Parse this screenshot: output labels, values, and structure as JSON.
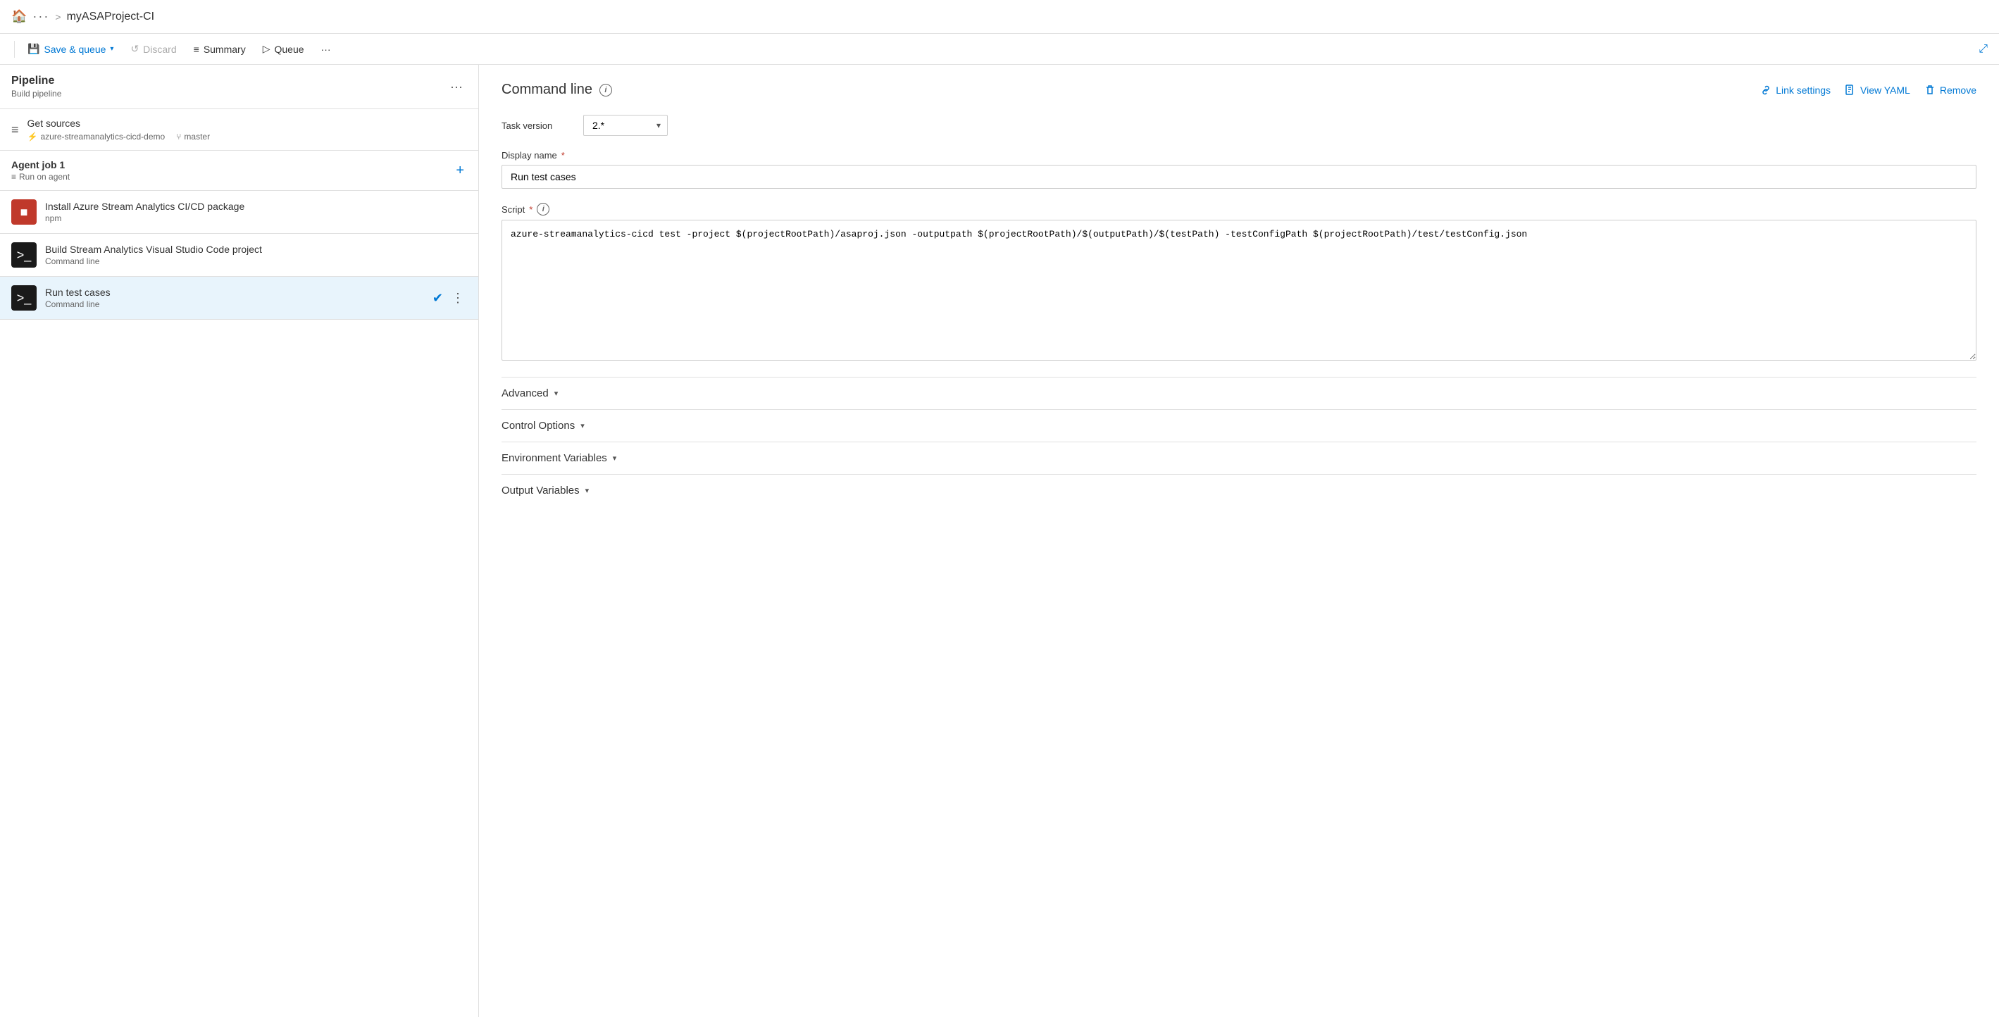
{
  "topbar": {
    "icon": "🏠",
    "dots": "···",
    "separator": ">",
    "title": "myASAProject-CI"
  },
  "toolbar": {
    "save_queue": "Save & queue",
    "discard": "Discard",
    "summary": "Summary",
    "queue": "Queue",
    "more": "···",
    "expand": "⤢"
  },
  "left_panel": {
    "pipeline_title": "Pipeline",
    "pipeline_subtitle": "Build pipeline",
    "get_sources_title": "Get sources",
    "get_sources_repo": "azure-streamanalytics-cicd-demo",
    "get_sources_branch": "master",
    "agent_job_title": "Agent job 1",
    "agent_job_sub": "Run on agent",
    "tasks": [
      {
        "id": "install",
        "icon_type": "red",
        "icon_text": "■",
        "title": "Install Azure Stream Analytics CI/CD package",
        "subtitle": "npm",
        "selected": false
      },
      {
        "id": "build",
        "icon_type": "dark",
        "icon_text": ">_",
        "title": "Build Stream Analytics Visual Studio Code project",
        "subtitle": "Command line",
        "selected": false
      },
      {
        "id": "run",
        "icon_type": "dark",
        "icon_text": ">_",
        "title": "Run test cases",
        "subtitle": "Command line",
        "selected": true
      }
    ]
  },
  "right_panel": {
    "command_title": "Command line",
    "info_icon": "i",
    "link_settings": "Link settings",
    "view_yaml": "View YAML",
    "remove": "Remove",
    "task_version_label": "Task version",
    "task_version_value": "2.*",
    "display_name_label": "Display name",
    "display_name_required": "*",
    "display_name_value": "Run test cases",
    "script_label": "Script",
    "script_required": "*",
    "script_value": "azure-streamanalytics-cicd test -project $(projectRootPath)/asaproj.json -outputpath $(projectRootPath)/$(outputPath)/$(testPath) -testConfigPath $(projectRootPath)/test/testConfig.json",
    "sections": [
      {
        "id": "advanced",
        "label": "Advanced"
      },
      {
        "id": "control-options",
        "label": "Control Options"
      },
      {
        "id": "environment-variables",
        "label": "Environment Variables"
      },
      {
        "id": "output-variables",
        "label": "Output Variables"
      }
    ]
  }
}
